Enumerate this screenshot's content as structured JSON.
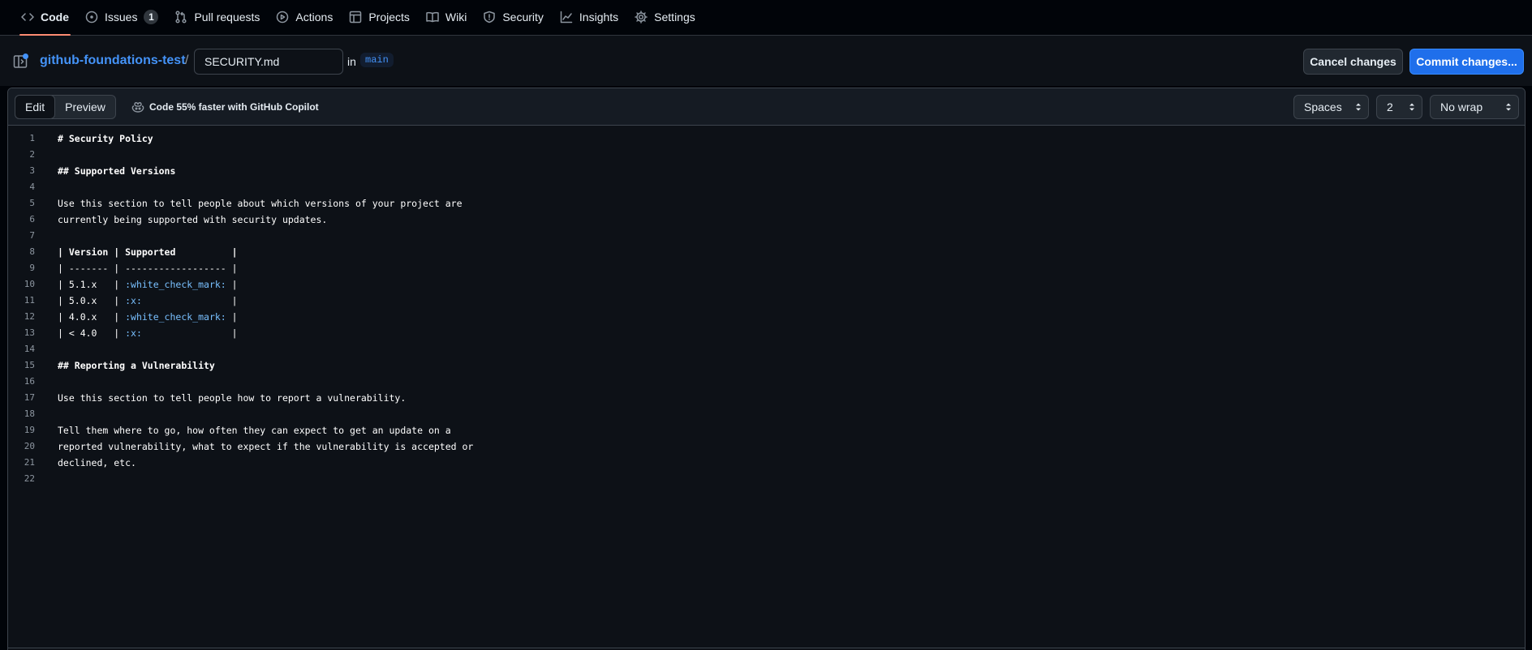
{
  "nav": {
    "tabs": [
      {
        "label": "Code",
        "icon": "code-icon"
      },
      {
        "label": "Issues",
        "icon": "issue-icon",
        "count": "1"
      },
      {
        "label": "Pull requests",
        "icon": "pull-request-icon"
      },
      {
        "label": "Actions",
        "icon": "play-icon"
      },
      {
        "label": "Projects",
        "icon": "table-icon"
      },
      {
        "label": "Wiki",
        "icon": "book-icon"
      },
      {
        "label": "Security",
        "icon": "shield-icon"
      },
      {
        "label": "Insights",
        "icon": "graph-icon"
      },
      {
        "label": "Settings",
        "icon": "gear-icon"
      }
    ]
  },
  "file": {
    "repo": "github-foundations-test",
    "separator": "/",
    "filename": "SECURITY.md",
    "in_label": "in",
    "branch": "main",
    "cancel_label": "Cancel changes",
    "commit_label": "Commit changes..."
  },
  "toolbar": {
    "edit_label": "Edit",
    "preview_label": "Preview",
    "copilot_text": "Code 55% faster with GitHub Copilot",
    "indent_mode": "Spaces",
    "indent_size": "2",
    "wrap_mode": "No wrap"
  },
  "code_lines": [
    "# Security Policy",
    "",
    "## Supported Versions",
    "",
    "Use this section to tell people about which versions of your project are",
    "currently being supported with security updates.",
    "",
    "| Version | Supported          |",
    "| ------- | ------------------ |",
    "| 5.1.x   | :white_check_mark: |",
    "| 5.0.x   | :x:                |",
    "| 4.0.x   | :white_check_mark: |",
    "| < 4.0   | :x:                |",
    "",
    "## Reporting a Vulnerability",
    "",
    "Use this section to tell people how to report a vulnerability.",
    "",
    "Tell them where to go, how often they can expect to get an update on a",
    "reported vulnerability, what to expect if the vulnerability is accepted or",
    "declined, etc.",
    ""
  ],
  "colors": {
    "accent": "#4493f8",
    "active_tab_underline": "#fd8c73",
    "commit_button": "#1f6feb",
    "emoji_shortcode": "#79c0ff"
  }
}
